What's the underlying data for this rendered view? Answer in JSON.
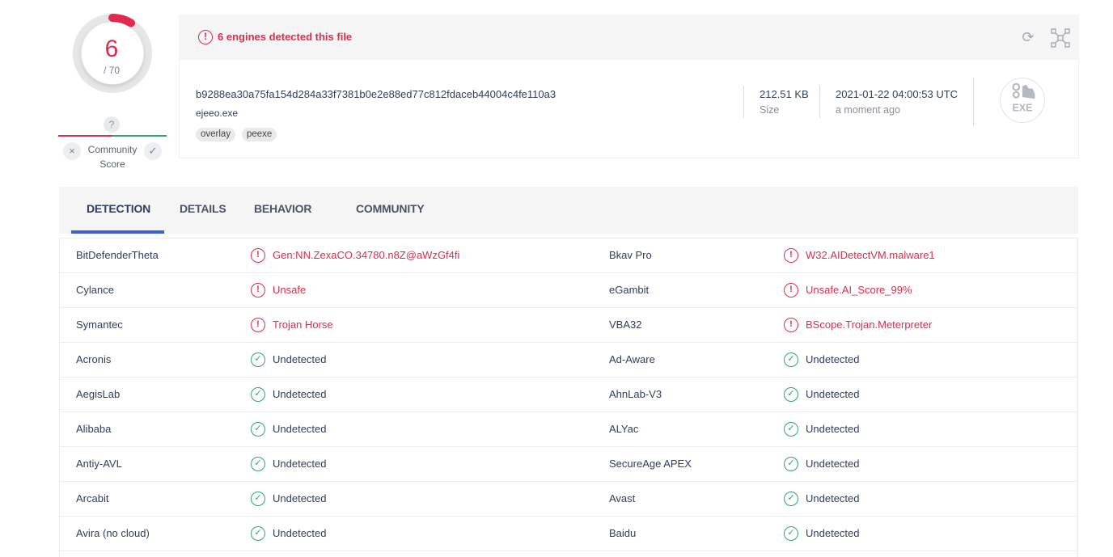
{
  "score": {
    "detected": "6",
    "total": "/ 70"
  },
  "community": {
    "unknown": "?",
    "label": "Community Score",
    "down_icon": "×",
    "up_icon": "✓"
  },
  "alert": {
    "icon": "!",
    "text": "6 engines detected this file"
  },
  "toolbar": {
    "reload_icon": "⟳"
  },
  "file": {
    "hash": "b9288ea30a75fa154d284a33f7381b0e2e88ed77c812fdaceb44004c4fe110a3",
    "name": "ejeeo.exe",
    "tags": [
      "overlay",
      "peexe"
    ],
    "size": "212.51 KB",
    "size_label": "Size",
    "date": "2021-01-22 04:00:53 UTC",
    "date_label": "a moment ago",
    "type_badge": "EXE"
  },
  "tabs": [
    "DETECTION",
    "DETAILS",
    "BEHAVIOR",
    "COMMUNITY"
  ],
  "colors": {
    "malicious": "#e22b4c",
    "clean": "#2ea66f",
    "accent": "#3b61d8"
  },
  "detections": [
    {
      "left": {
        "engine": "BitDefenderTheta",
        "result": "Gen:NN.ZexaCO.34780.n8Z@aWzGf4fi",
        "status": "malicious"
      },
      "right": {
        "engine": "Bkav Pro",
        "result": "W32.AIDetectVM.malware1",
        "status": "malicious"
      }
    },
    {
      "left": {
        "engine": "Cylance",
        "result": "Unsafe",
        "status": "malicious"
      },
      "right": {
        "engine": "eGambit",
        "result": "Unsafe.AI_Score_99%",
        "status": "malicious"
      }
    },
    {
      "left": {
        "engine": "Symantec",
        "result": "Trojan Horse",
        "status": "malicious"
      },
      "right": {
        "engine": "VBA32",
        "result": "BScope.Trojan.Meterpreter",
        "status": "malicious"
      }
    },
    {
      "left": {
        "engine": "Acronis",
        "result": "Undetected",
        "status": "clean"
      },
      "right": {
        "engine": "Ad-Aware",
        "result": "Undetected",
        "status": "clean"
      }
    },
    {
      "left": {
        "engine": "AegisLab",
        "result": "Undetected",
        "status": "clean"
      },
      "right": {
        "engine": "AhnLab-V3",
        "result": "Undetected",
        "status": "clean"
      }
    },
    {
      "left": {
        "engine": "Alibaba",
        "result": "Undetected",
        "status": "clean"
      },
      "right": {
        "engine": "ALYac",
        "result": "Undetected",
        "status": "clean"
      }
    },
    {
      "left": {
        "engine": "Antiy-AVL",
        "result": "Undetected",
        "status": "clean"
      },
      "right": {
        "engine": "SecureAge APEX",
        "result": "Undetected",
        "status": "clean"
      }
    },
    {
      "left": {
        "engine": "Arcabit",
        "result": "Undetected",
        "status": "clean"
      },
      "right": {
        "engine": "Avast",
        "result": "Undetected",
        "status": "clean"
      }
    },
    {
      "left": {
        "engine": "Avira (no cloud)",
        "result": "Undetected",
        "status": "clean"
      },
      "right": {
        "engine": "Baidu",
        "result": "Undetected",
        "status": "clean"
      }
    }
  ]
}
